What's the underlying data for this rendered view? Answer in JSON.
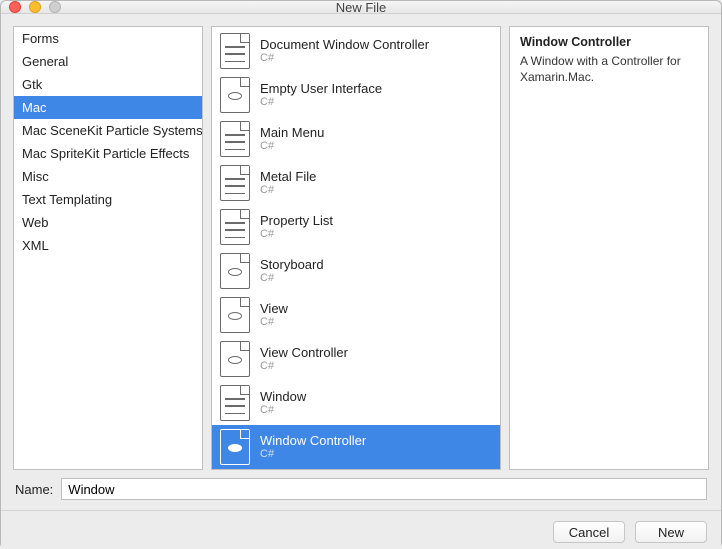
{
  "window": {
    "title": "New File"
  },
  "categories": [
    {
      "label": "Forms",
      "selected": false
    },
    {
      "label": "General",
      "selected": false
    },
    {
      "label": "Gtk",
      "selected": false
    },
    {
      "label": "Mac",
      "selected": true
    },
    {
      "label": "Mac SceneKit Particle Systems",
      "selected": false
    },
    {
      "label": "Mac SpriteKit Particle Effects",
      "selected": false
    },
    {
      "label": "Misc",
      "selected": false
    },
    {
      "label": "Text Templating",
      "selected": false
    },
    {
      "label": "Web",
      "selected": false
    },
    {
      "label": "XML",
      "selected": false
    }
  ],
  "templates": [
    {
      "name": "Document Window Controller",
      "lang": "C#",
      "icon": "doc",
      "selected": false
    },
    {
      "name": "Empty User Interface",
      "lang": "C#",
      "icon": "eye",
      "selected": false
    },
    {
      "name": "Main Menu",
      "lang": "C#",
      "icon": "doc",
      "selected": false
    },
    {
      "name": "Metal File",
      "lang": "C#",
      "icon": "doc",
      "selected": false
    },
    {
      "name": "Property List",
      "lang": "C#",
      "icon": "doc",
      "selected": false
    },
    {
      "name": "Storyboard",
      "lang": "C#",
      "icon": "eye",
      "selected": false
    },
    {
      "name": "View",
      "lang": "C#",
      "icon": "eye",
      "selected": false
    },
    {
      "name": "View Controller",
      "lang": "C#",
      "icon": "eye",
      "selected": false
    },
    {
      "name": "Window",
      "lang": "C#",
      "icon": "doc",
      "selected": false
    },
    {
      "name": "Window Controller",
      "lang": "C#",
      "icon": "eye",
      "selected": true
    }
  ],
  "detail": {
    "title": "Window Controller",
    "description": "A Window with a Controller for Xamarin.Mac."
  },
  "name_field": {
    "label": "Name:",
    "value": "Window"
  },
  "buttons": {
    "cancel": "Cancel",
    "new": "New"
  }
}
